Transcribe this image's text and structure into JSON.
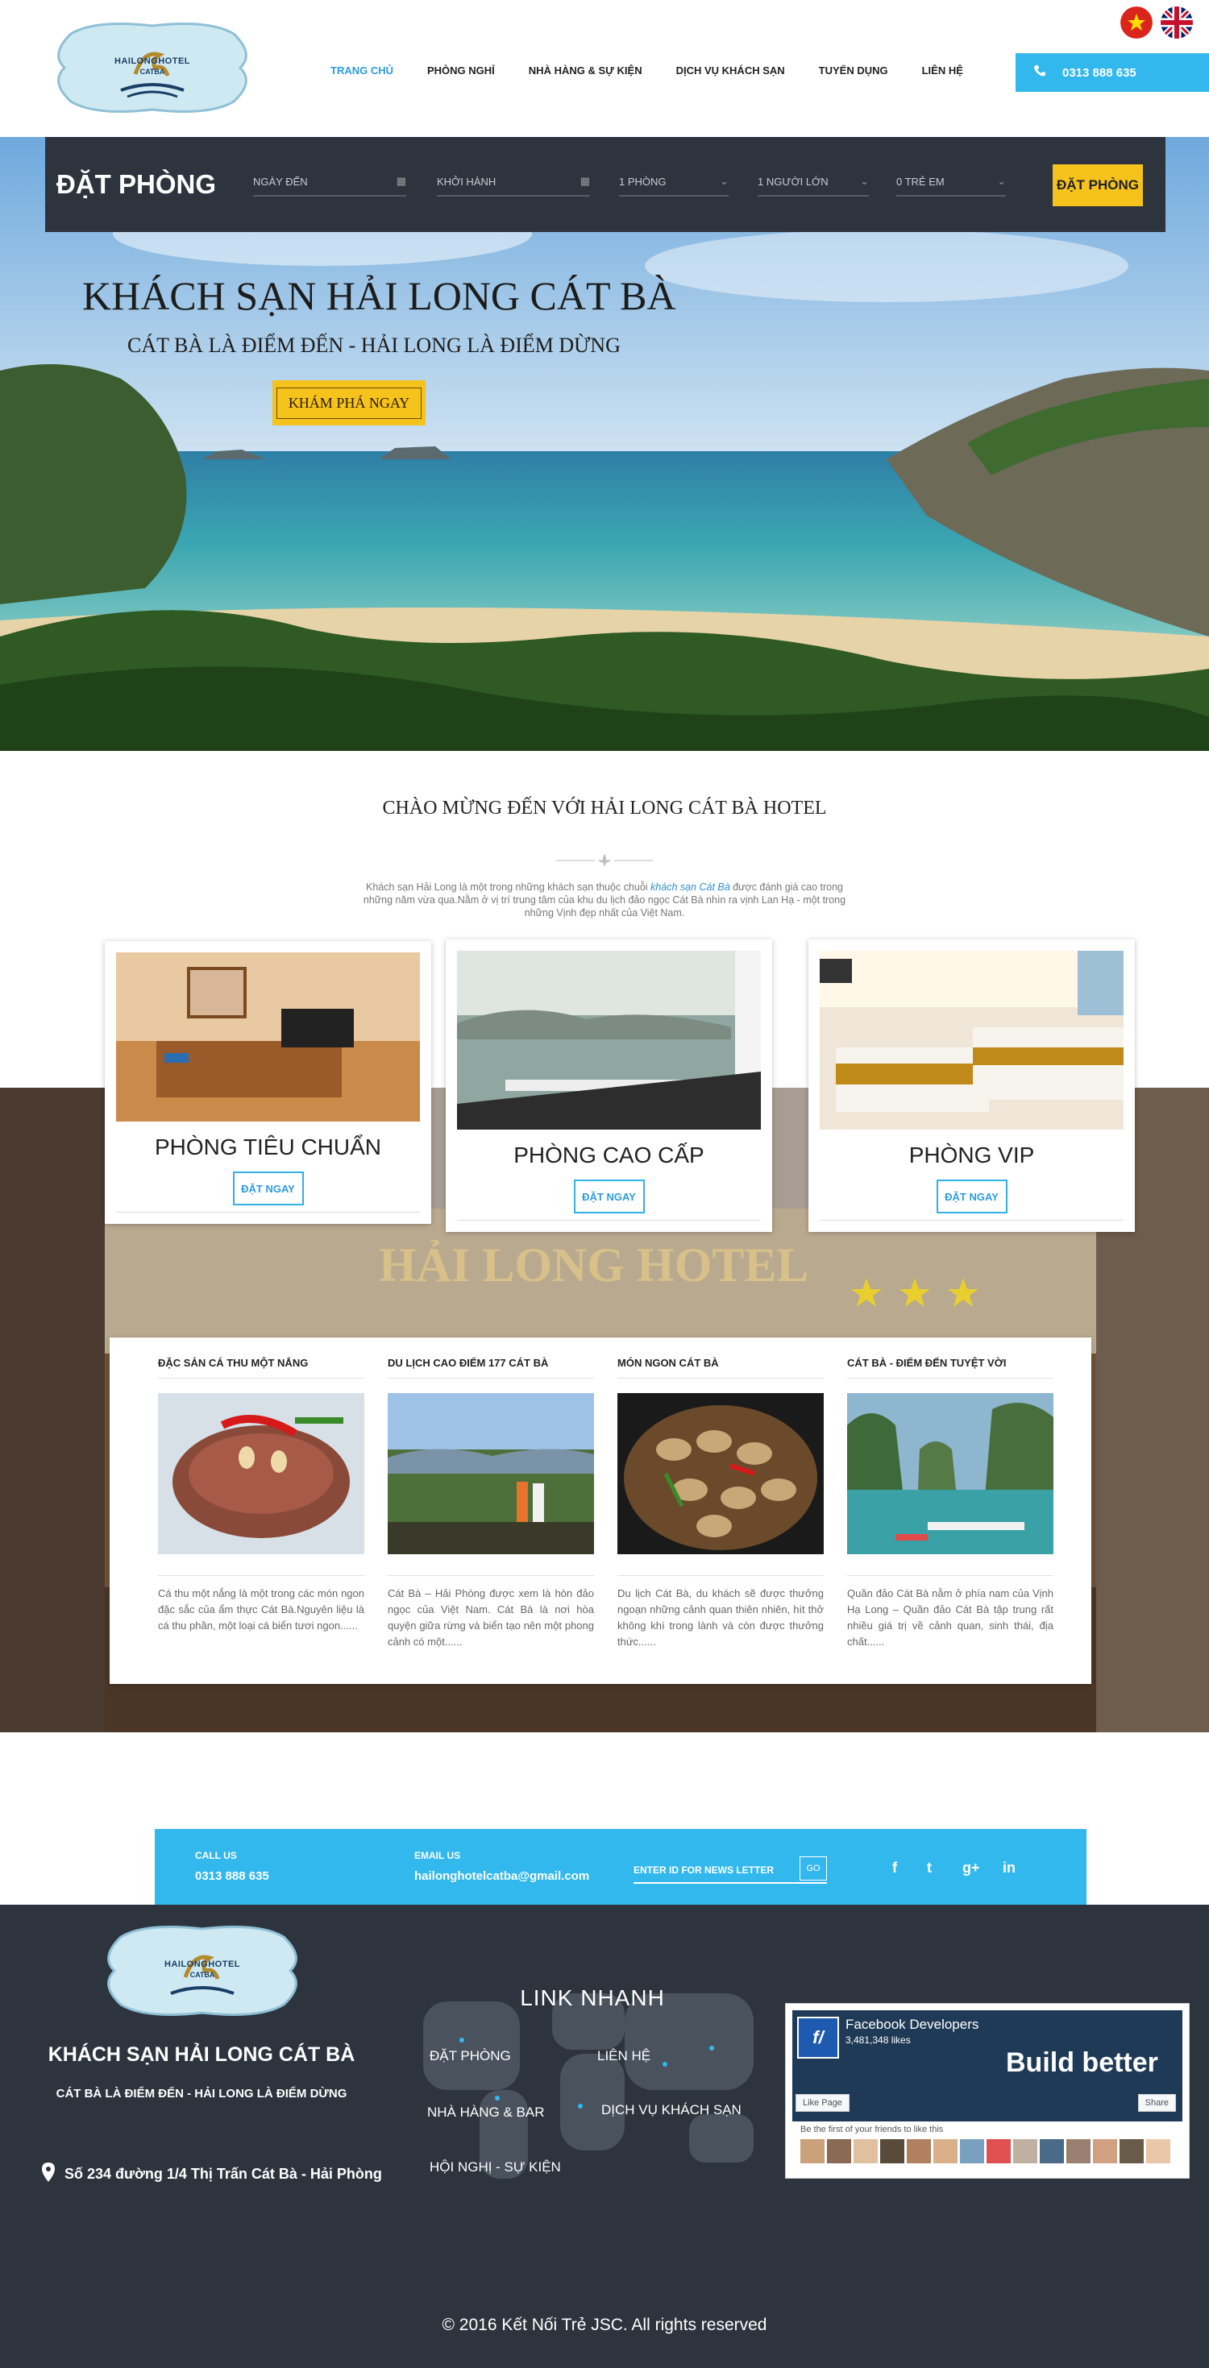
{
  "header": {
    "logo_text": "HAILONGHOTEL",
    "logo_sub": "CATBA",
    "nav": [
      {
        "label": "TRANG CHỦ"
      },
      {
        "label": "PHÒNG NGHỈ"
      },
      {
        "label": "NHÀ HÀNG & SỰ KIỆN"
      },
      {
        "label": "DỊCH VỤ KHÁCH SẠN"
      },
      {
        "label": "TUYỂN DỤNG"
      },
      {
        "label": "LIÊN HỆ"
      }
    ],
    "phone": "0313 888 635",
    "phone_icon": "phone-icon",
    "flags": [
      "vietnam-flag",
      "uk-flag"
    ]
  },
  "booking": {
    "title": "ĐẶT PHÒNG",
    "checkin_placeholder": "NGÀY ĐẾN",
    "checkout_placeholder": "KHỞI HÀNH",
    "rooms": "1 PHÒNG",
    "adults": "1 NGƯỜI LỚN",
    "children": "0 TRẺ EM",
    "submit": "ĐẶT PHÒNG"
  },
  "hero": {
    "title": "KHÁCH SẠN HẢI LONG CÁT BÀ",
    "subtitle": "CÁT BÀ LÀ ĐIỂM ĐẾN - HẢI LONG LÀ ĐIỂM DỪNG",
    "cta": "KHÁM PHÁ NGAY"
  },
  "welcome": {
    "title": "CHÀO MỪNG ĐẾN VỚI HẢI LONG CÁT BÀ HOTEL",
    "text_before": "Khách sạn Hải Long là một trong những khách sạn thuộc chuỗi ",
    "text_link": "khách sạn Cát Bà",
    "text_after": " được đánh giá cao trong những năm vừa qua.Nằm ở vị trí trung tâm của khu du lịch đảo ngọc Cát Bà nhìn ra vịnh Lan Hạ - một trong những Vịnh đẹp nhất của Việt Nam."
  },
  "rooms": [
    {
      "name": "PHÒNG TIÊU CHUẨN",
      "button": "ĐẶT NGAY"
    },
    {
      "name": "PHÒNG CAO CẤP",
      "button": "ĐẶT NGAY"
    },
    {
      "name": "PHÒNG VIP",
      "button": "ĐẶT NGAY"
    }
  ],
  "lobby_sign": "HẢI LONG HOTEL",
  "news": [
    {
      "title": "ĐẶC SẢN CÁ THU MỘT NẮNG",
      "text": "Cá thu một nắng là một trong các món ngon đặc sắc của ẩm thực Cát Bà.Nguyên liệu là cá thu phần, một loại cá biển tươi ngon......"
    },
    {
      "title": "DU LỊCH CAO ĐIỂM 177 CÁT BÀ",
      "text": "Cát Bà – Hải Phòng được xem là hòn đảo ngọc của Việt Nam. Cát Bà là nơi hòa quyện giữa rừng và biển tạo nên một phong cảnh có một......"
    },
    {
      "title": "MÓN NGON CÁT BÀ",
      "text": "Du lịch Cát Bà, du khách sẽ được thưởng ngoạn những cảnh quan thiên nhiên, hít thở không khí trong lành và còn được thưởng thức......"
    },
    {
      "title": "CÁT BÀ - ĐIỂM ĐẾN TUYỆT VỜI",
      "text": "Quần đảo Cát Bà nằm ở phía nam của Vịnh Hạ Long – Quần đảo Cát Bà tập trung rất nhiều giá trị về cảnh quan, sinh thái, địa chất......"
    }
  ],
  "contact": {
    "call_label": "CALL US",
    "call_value": "0313 888 635",
    "email_label": "EMAIL US",
    "email_value": "hailonghotelcatba@gmail.com",
    "newsletter_placeholder": "ENTER ID  FOR NEWS LETTER",
    "go": "GO",
    "social": [
      "f",
      "t",
      "g+",
      "in"
    ]
  },
  "footer": {
    "logo_text": "HAILONGHOTEL",
    "logo_sub": "CATBA",
    "name": "KHÁCH SẠN HẢI LONG CÁT BÀ",
    "slogan": "CÁT BÀ LÀ ĐIỂM ĐẾN - HẢI LONG LÀ ĐIỂM DỪNG",
    "address": "Số 234 đường 1/4 Thị Trấn Cát Bà - Hải Phòng",
    "links_title": "LINK NHANH",
    "links": [
      "ĐẶT PHÒNG",
      "LIÊN HỆ",
      "NHÀ HÀNG & BAR",
      "DỊCH VỤ KHÁCH SẠN",
      "HỘI NGHỊ - SỰ KIỆN"
    ],
    "fb_name": "Facebook Developers",
    "fb_likes": "3,481,348 likes",
    "fb_banner": "Build better",
    "fb_like": "Like Page",
    "fb_share": "Share",
    "fb_first": "Be the first of your friends to like this",
    "copyright": "© 2016 Kết Nối Trẻ JSC. All rights reserved"
  },
  "colors": {
    "accent": "#33b8ee",
    "cta": "#f6c21c",
    "dark": "#2d343e",
    "active_nav": "#2b9be0"
  }
}
